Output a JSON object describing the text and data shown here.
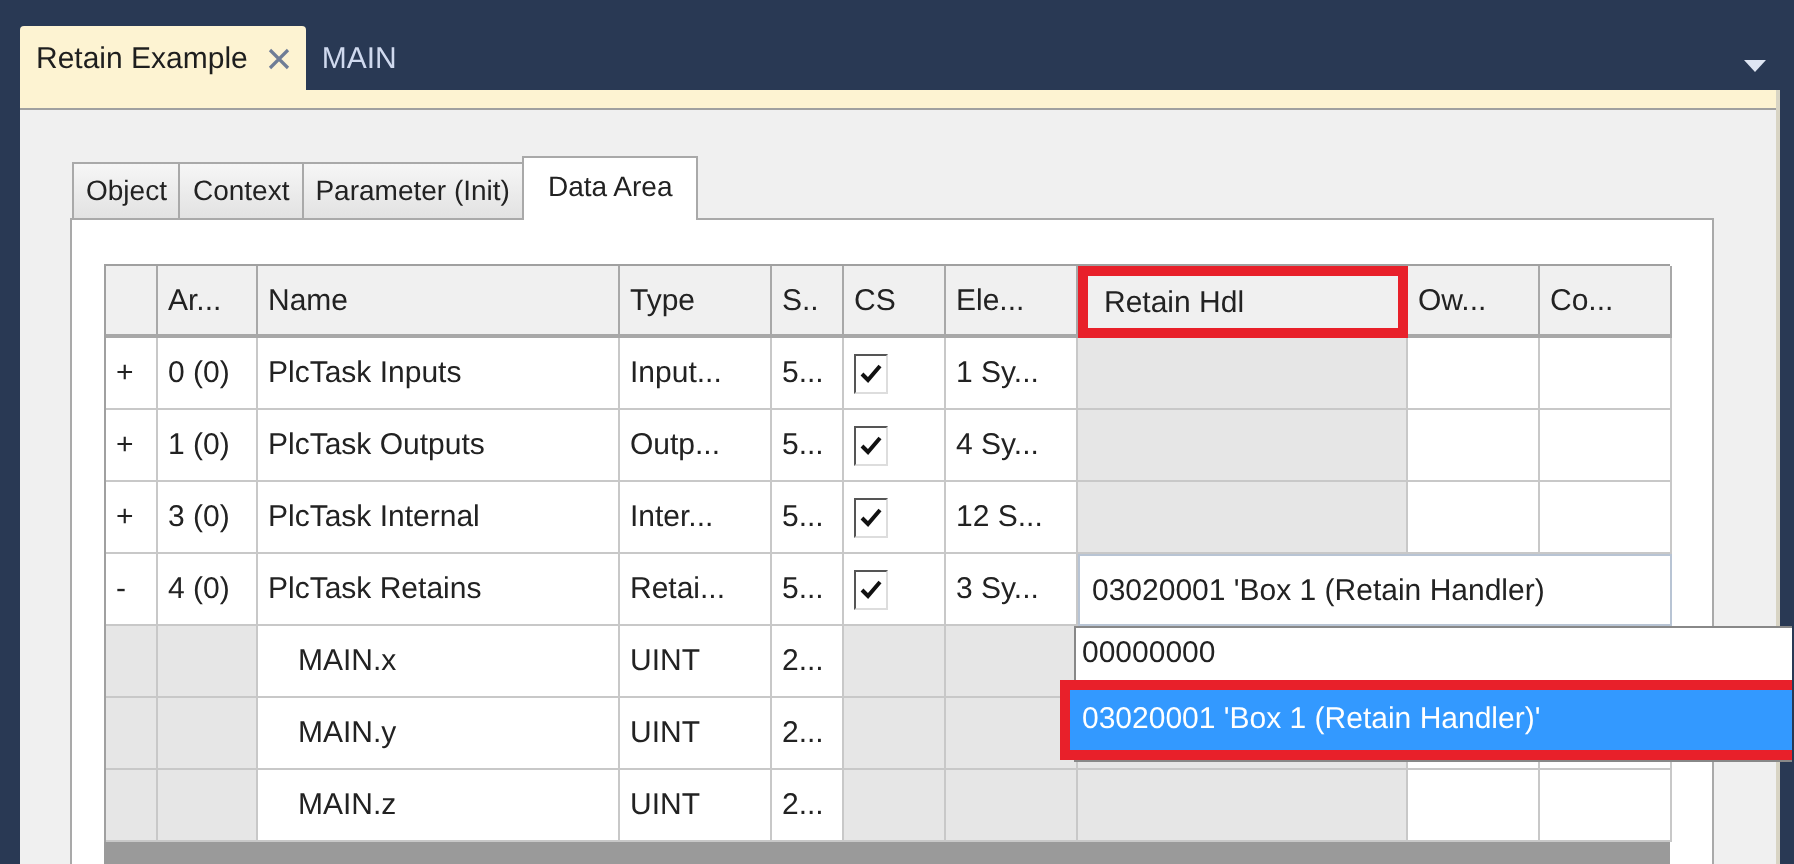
{
  "document_tabs": [
    {
      "label": "Retain Example",
      "selected": true,
      "closable": true
    },
    {
      "label": "MAIN",
      "selected": false,
      "closable": false
    }
  ],
  "property_tabs": [
    {
      "label": "Object",
      "selected": false
    },
    {
      "label": "Context",
      "selected": false
    },
    {
      "label": "Parameter (Init)",
      "selected": false
    },
    {
      "label": "Data Area",
      "selected": true
    }
  ],
  "table": {
    "columns": [
      {
        "label": "Ar...",
        "highlighted": false
      },
      {
        "label": "Name",
        "highlighted": false
      },
      {
        "label": "Type",
        "highlighted": false
      },
      {
        "label": "S..",
        "highlighted": false
      },
      {
        "label": "CS",
        "highlighted": false
      },
      {
        "label": "Ele...",
        "highlighted": false
      },
      {
        "label": "Retain Hdl",
        "highlighted": true
      },
      {
        "label": "Ow...",
        "highlighted": false
      },
      {
        "label": "Co...",
        "highlighted": false
      }
    ],
    "rows": [
      {
        "kind": "group",
        "expander": "+",
        "area": "0 (0)",
        "name": "PlcTask Inputs",
        "type": "Input...",
        "size": "5...",
        "cs_checked": true,
        "elements": "1 Sy...",
        "hdl_disabled": true
      },
      {
        "kind": "group",
        "expander": "+",
        "area": "1 (0)",
        "name": "PlcTask Outputs",
        "type": "Outp...",
        "size": "5...",
        "cs_checked": true,
        "elements": "4 Sy...",
        "hdl_disabled": true
      },
      {
        "kind": "group",
        "expander": "+",
        "area": "3 (0)",
        "name": "PlcTask Internal",
        "type": "Inter...",
        "size": "5...",
        "cs_checked": true,
        "elements": "12 S...",
        "hdl_disabled": true
      },
      {
        "kind": "group",
        "expander": "-",
        "area": "4 (0)",
        "name": "PlcTask Retains",
        "type": "Retai...",
        "size": "5...",
        "cs_checked": true,
        "elements": "3 Sy...",
        "retain_hdl": "03020001 'Box 1 (Retain Handler)"
      },
      {
        "kind": "variable",
        "name": "MAIN.x",
        "type": "UINT",
        "size": "2..."
      },
      {
        "kind": "variable",
        "name": "MAIN.y",
        "type": "UINT",
        "size": "2..."
      },
      {
        "kind": "variable",
        "name": "MAIN.z",
        "type": "UINT",
        "size": "2..."
      }
    ]
  },
  "retain_dropdown": {
    "options": [
      {
        "label": "00000000",
        "selected": false,
        "highlighted": false
      },
      {
        "label": "03020001 'Box 1 (Retain Handler)'",
        "selected": true,
        "highlighted": true
      }
    ]
  }
}
